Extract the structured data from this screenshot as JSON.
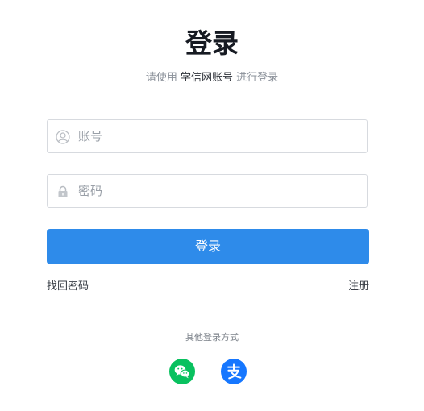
{
  "title": "登录",
  "subtitle": {
    "prefix": "请使用 ",
    "highlight": "学信网账号",
    "suffix": " 进行登录"
  },
  "account_field": {
    "placeholder": "账号",
    "value": "",
    "icon": "user-icon"
  },
  "password_field": {
    "placeholder": "密码",
    "value": "",
    "icon": "lock-icon"
  },
  "login_button": "登录",
  "links": {
    "forgot_password": "找回密码",
    "register": "注册"
  },
  "other_login": {
    "label": "其他登录方式",
    "methods": [
      {
        "icon": "wechat-icon",
        "color": "#09c15f"
      },
      {
        "icon": "alipay-icon",
        "color": "#1677ff"
      }
    ]
  },
  "colors": {
    "primary": "#2e8bea",
    "text": "#161a22",
    "muted": "#8a9099"
  }
}
